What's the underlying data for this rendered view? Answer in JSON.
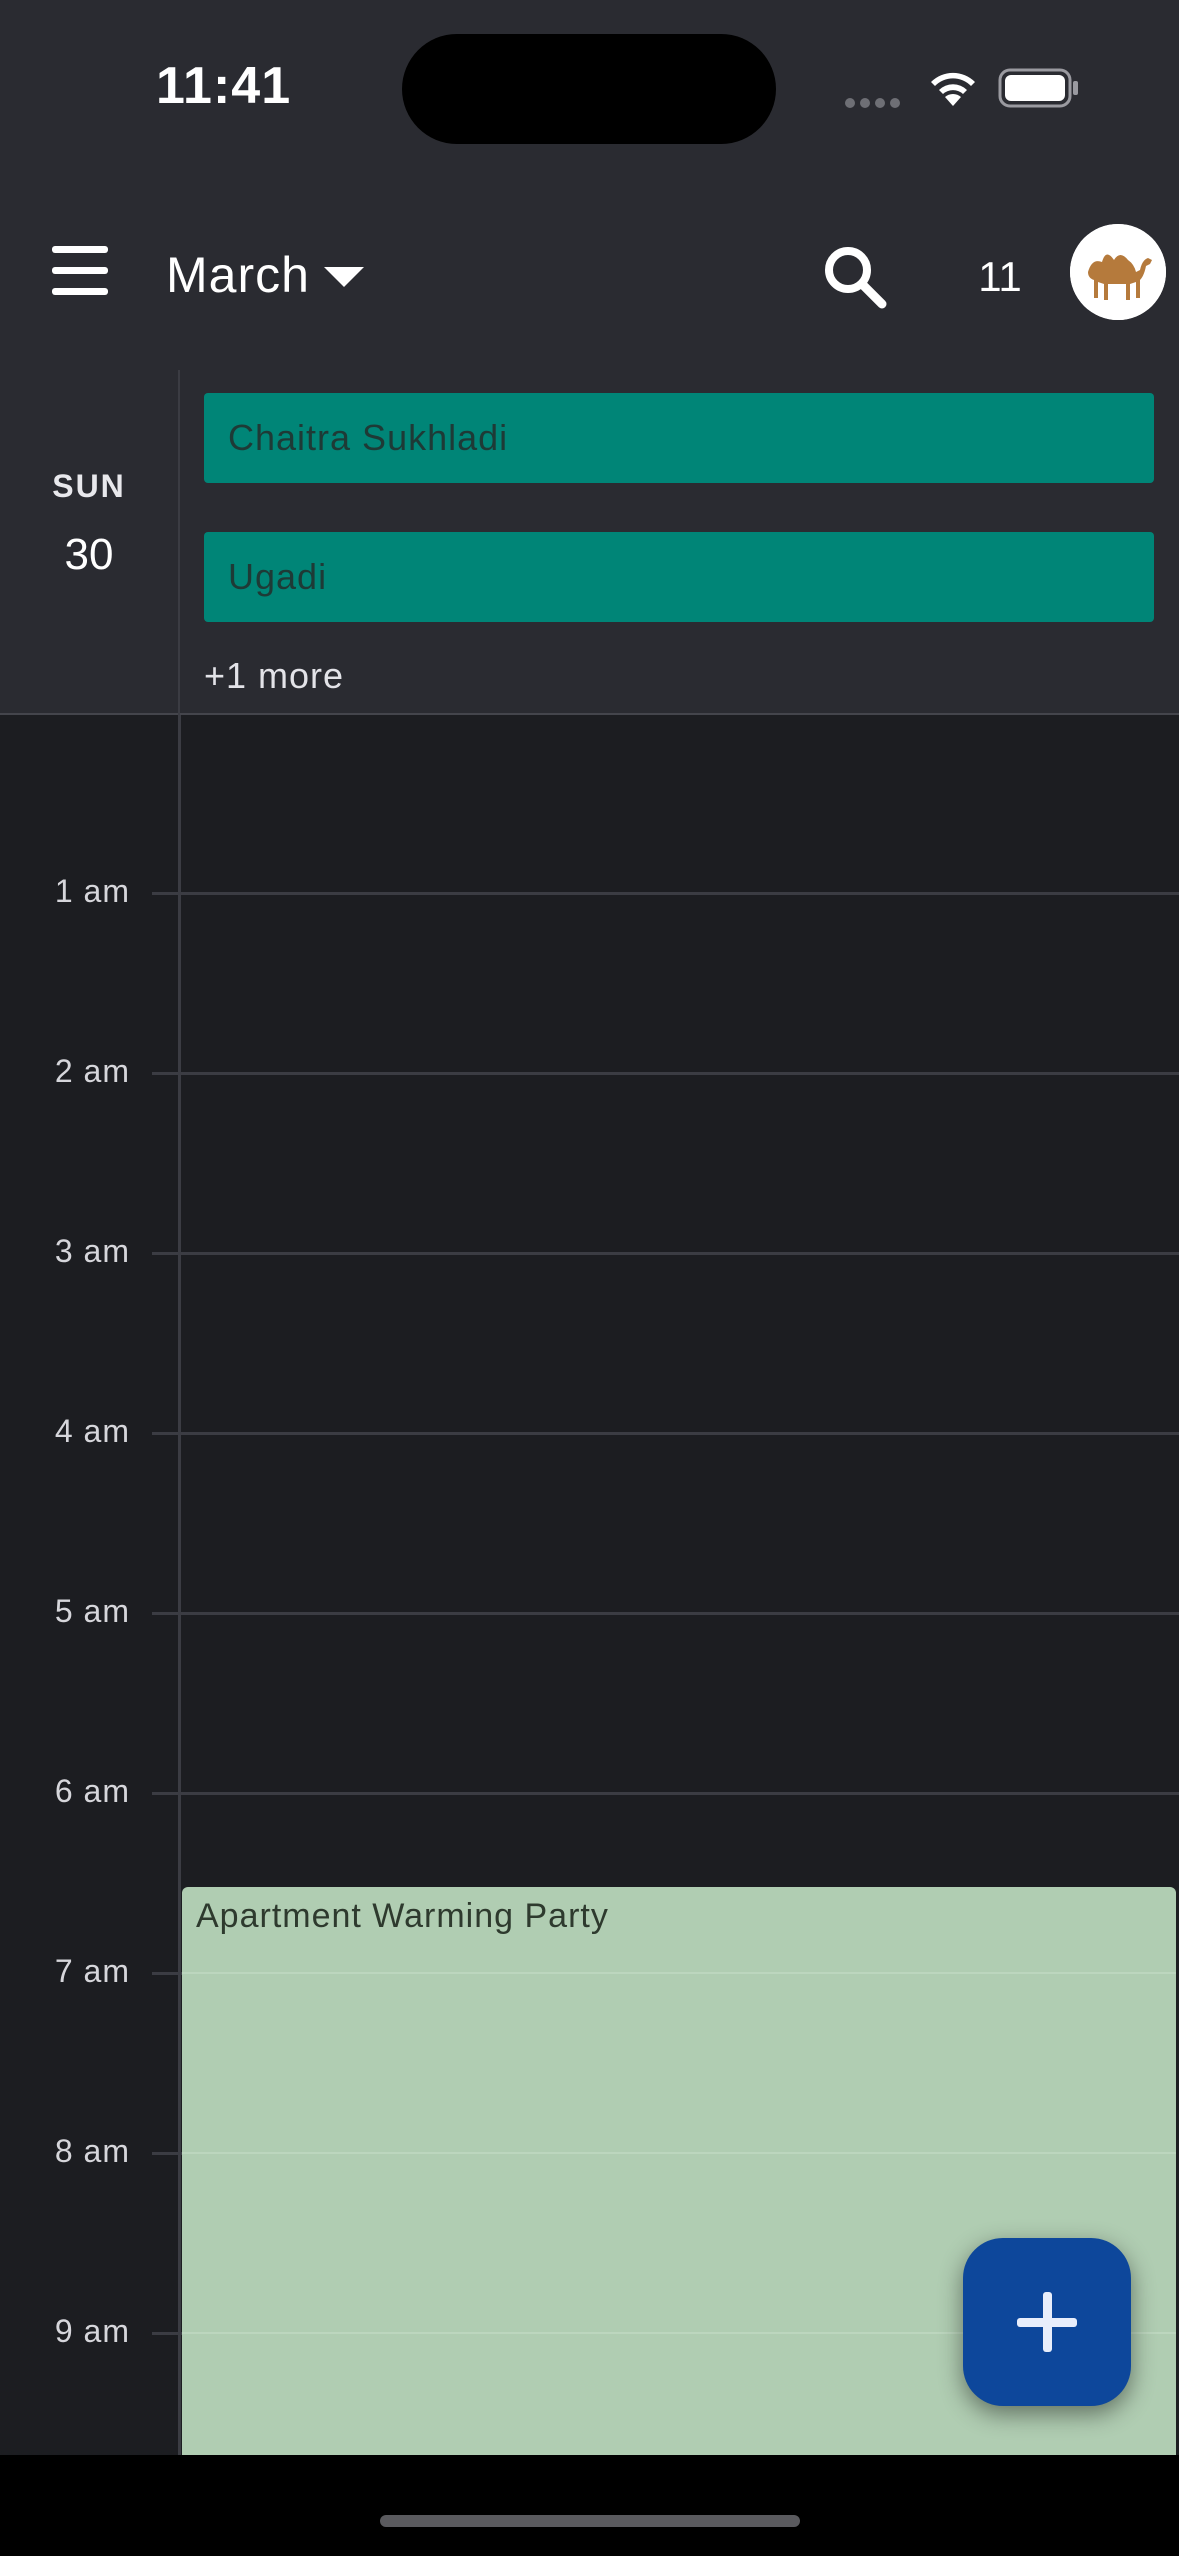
{
  "status_bar": {
    "time": "11:41"
  },
  "header": {
    "month": "March",
    "today_number": "11"
  },
  "day": {
    "name": "SUN",
    "number": "30"
  },
  "all_day_events": [
    {
      "title": "Chaitra Sukhladi",
      "color": "#008577"
    },
    {
      "title": "Ugadi",
      "color": "#008577"
    }
  ],
  "more_link": "+1 more",
  "hours": [
    "1 am",
    "2 am",
    "3 am",
    "4 am",
    "5 am",
    "6 am",
    "7 am",
    "8 am",
    "9 am"
  ],
  "events": [
    {
      "title": "Apartment Warming Party",
      "color": "#b0cdb2"
    }
  ],
  "icons": {
    "menu": "hamburger-menu-icon",
    "caret": "caret-down-icon",
    "search": "search-icon",
    "avatar": "camel-avatar",
    "fab": "plus-icon"
  },
  "colors": {
    "header_bg": "#2a2b31",
    "grid_bg": "#1c1d21",
    "fab": "#0d479b"
  }
}
